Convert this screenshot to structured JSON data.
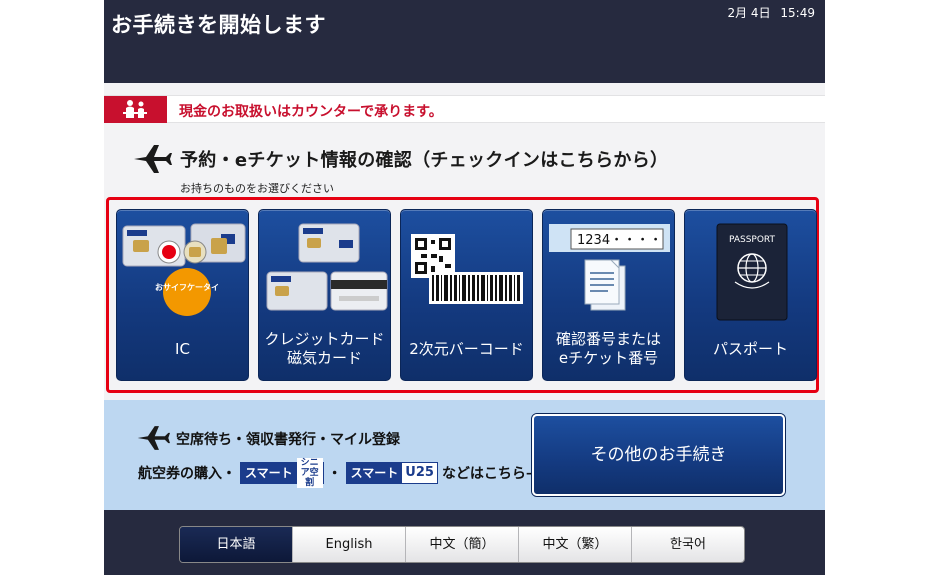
{
  "header": {
    "title": "お手続きを開始します",
    "date": "2月 4日",
    "time": "15:49"
  },
  "notice": {
    "text": "現金のお取扱いはカウンターで承ります。",
    "icon": "counter-staff-icon"
  },
  "checkin": {
    "title": "予約・eチケット情報の確認（チェックインはこちらから）",
    "subtitle": "お持ちのものをお選びください",
    "options": [
      {
        "line1": "IC",
        "line2": "",
        "icon": "ic-card-icon",
        "badge_text": "おサイフケータイ"
      },
      {
        "line1": "クレジットカード",
        "line2": "磁気カード",
        "icon": "magnetic-card-icon"
      },
      {
        "line1": "2次元バーコード",
        "line2": "",
        "icon": "barcode-icon"
      },
      {
        "line1": "確認番号または",
        "line2": "eチケット番号",
        "icon": "number-entry-icon",
        "field_text": "1234・・・・"
      },
      {
        "line1": "パスポート",
        "line2": "",
        "icon": "passport-icon",
        "passport_text": "PASSPORT"
      }
    ]
  },
  "other": {
    "line1": "空席待ち・領収書発行・マイル登録",
    "line2_prefix": "航空券の購入・",
    "badge1_main": "スマート",
    "badge1_sub": "シニア空割",
    "dot": "・",
    "badge2_main": "スマート",
    "badge2_num": "U25",
    "line2_suffix": "などはこちら→",
    "button_label": "その他のお手続き"
  },
  "languages": [
    {
      "label": "日本語",
      "active": true
    },
    {
      "label": "English",
      "active": false
    },
    {
      "label": "中文（簡）",
      "active": false
    },
    {
      "label": "中文（繁）",
      "active": false
    },
    {
      "label": "한국어",
      "active": false
    }
  ],
  "colors": {
    "header_bg": "#262a3f",
    "accent_red": "#c8102e",
    "button_blue": "#143a80",
    "band_blue": "#bdd7f1"
  }
}
